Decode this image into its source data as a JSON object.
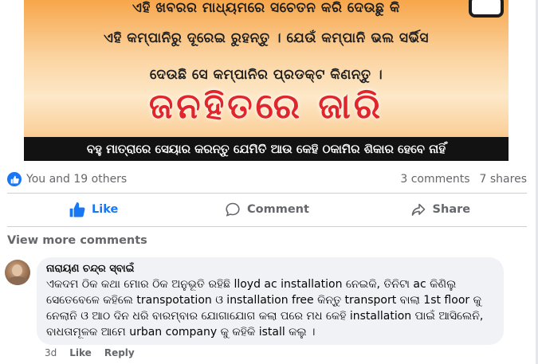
{
  "post_image": {
    "line1": "ଏହି ଖବରର ମାଧ୍ୟମରେ ସଚେତନ କରି ଦେଉଛୁ କି",
    "line2": "ଏହି କମ୍ପାନିରୁ ଦୂରେଇ ରୁହନ୍ତୁ । ଯେଉଁ କମ୍ପାନି ଭଲ ସର୍ଭିସ",
    "line3": "ଦେଉଛି ସେ କମ୍ପାନିର ପ୍ରଡକ୍ଟ କିଣନ୍ତୁ ।",
    "headline": "ଜନହିତରେ ଜାରି",
    "banner": "ବହୁ ମାତ୍ରାରେ ସେୟାର କରନ୍ତୁ ଯେମିତି ଆଉ କେହି ଠକାମିର ଶିକାର ହେବେ ନାହିଁ"
  },
  "reactions": {
    "summary": "You and 19 others",
    "comments_count": "3 comments",
    "shares_count": "7 shares"
  },
  "actions": {
    "like_label": "Like",
    "comment_label": "Comment",
    "share_label": "Share"
  },
  "comments_section": {
    "view_more": "View more comments",
    "comment": {
      "author": "ନାରାୟଣ ଚନ୍ଦ୍ର ସ୍ବାଇଁ",
      "text": "ଏକଦମ ଠିକ କଥା ମୋର ଠିକ ଅନୁଭୂତି ରହିଛି lloyd ac installation ନେଇକି, ତିନିଟା ac କିଣିଲୁ ସେତେବେଳେ କହିଲେ transpotation ଓ installation free କିନ୍ତୁ transport ବାଲା 1st floor କୁ ନେଲାନି ଓ ଆଠ ଦିନ ଧରି ବାରମ୍ବାର ଯୋଗାଯୋଗ କଲା ପରେ ମଧ କେହି installation ପାଇଁ ଆସିଲେନି, ବାଧତାମୂଳକ ଆମେ urban company କୁ କହିକି istall କଲୁ ।",
      "time": "3d",
      "like_label": "Like",
      "reply_label": "Reply"
    }
  },
  "colors": {
    "accent": "#1877f2",
    "muted_text": "#65676b",
    "bubble_bg": "#f0f2f5",
    "headline_red": "#e0262b"
  },
  "icons": {
    "reaction": "like-reaction-icon",
    "like": "thumbs-up-icon",
    "comment": "speech-bubble-icon",
    "share": "share-arrow-icon"
  }
}
